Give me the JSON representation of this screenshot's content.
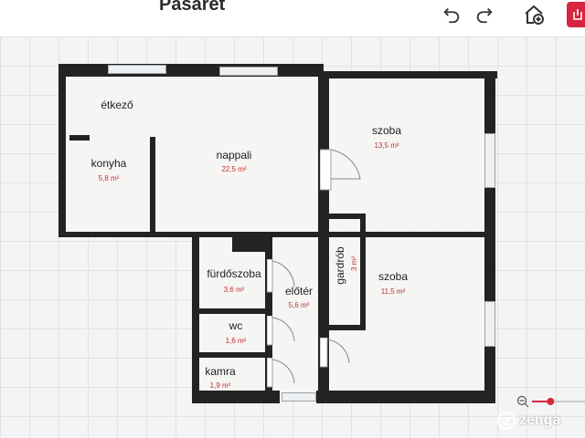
{
  "header": {
    "title": "Pasarét",
    "undo_icon": "undo-icon",
    "redo_icon": "redo-icon",
    "add_home_icon": "home-plus-icon",
    "export_icon": "export-icon",
    "accent": "#d7263d"
  },
  "floorplan": {
    "rooms": [
      {
        "name": "étkező",
        "area": ""
      },
      {
        "name": "konyha",
        "area": "5,8 m²"
      },
      {
        "name": "nappali",
        "area": "22,5 m²"
      },
      {
        "name": "szoba",
        "area": "13,5 m²"
      },
      {
        "name": "szoba",
        "area": "11,5 m²"
      },
      {
        "name": "fürdőszoba",
        "area": "3,6 m²"
      },
      {
        "name": "előtér",
        "area": "5,6 m²"
      },
      {
        "name": "wc",
        "area": "1,6 m²"
      },
      {
        "name": "kamra",
        "area": "1,9 m²"
      },
      {
        "name": "gardrób",
        "area": "3 m²"
      }
    ],
    "wall_color": "#232323",
    "area_color": "#c03030"
  },
  "zoom": {
    "minus_icon": "zoom-out-icon",
    "level": 0.35
  },
  "brand": {
    "name": "zenga",
    "icon": "zenga-logo-icon"
  }
}
